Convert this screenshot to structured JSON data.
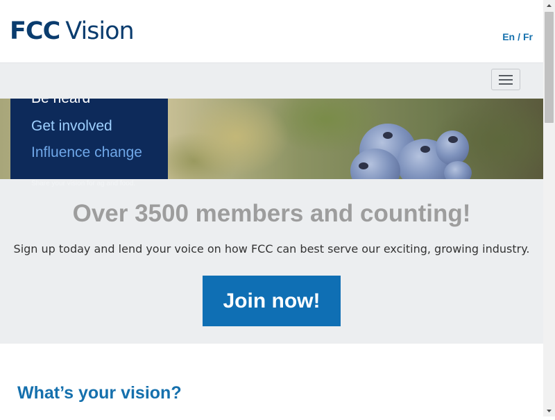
{
  "header": {
    "logo_bold": "FCC",
    "logo_light": "Vision",
    "lang_en": "En",
    "lang_sep": "/",
    "lang_fr": "Fr"
  },
  "navbar": {
    "toggle_icon": "hamburger-menu-icon"
  },
  "hero": {
    "line1": "Be heard",
    "line2": "Get involved",
    "line3": "Influence change",
    "subtitle": "Share your vision for ag and food."
  },
  "members": {
    "title": "Over 3500 members and counting!",
    "text": "Sign up today and lend your voice on how FCC can best serve our exciting, growing industry.",
    "join_label": "Join now!"
  },
  "vision": {
    "heading": "What’s your vision?"
  },
  "colors": {
    "brand_navy": "#0d2a5a",
    "accent_blue": "#0f6fb4",
    "link_blue": "#1570ad",
    "panel_grey": "#eceef0"
  }
}
